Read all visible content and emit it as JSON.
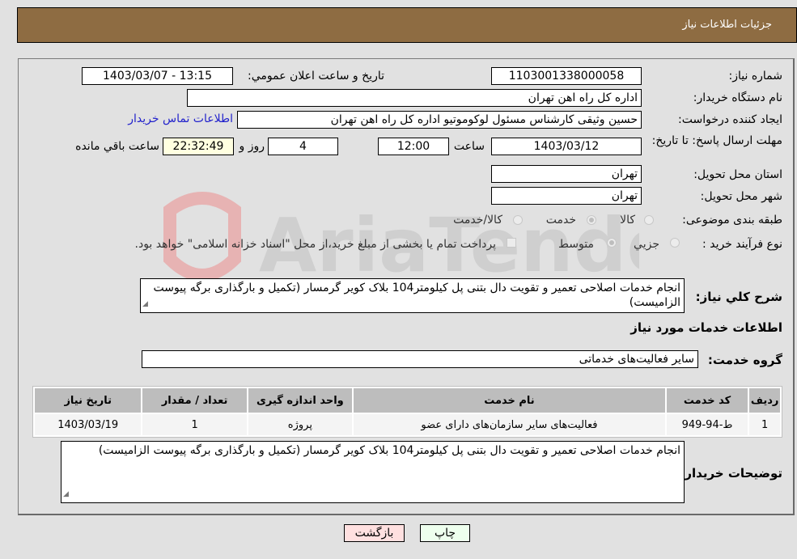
{
  "header": {
    "title": "جزئیات اطلاعات نیاز"
  },
  "form": {
    "need_number": {
      "label": "شماره نیاز:",
      "value": "1103001338000058"
    },
    "announce_datetime": {
      "label": "تاریخ و ساعت اعلان عمومي:",
      "value": "1403/03/07 - 13:15"
    },
    "buyer_org": {
      "label": "نام دستگاه خریدار:",
      "value": "اداره کل راه اهن تهران"
    },
    "requester": {
      "label": "ایجاد کننده درخواست:",
      "value": "حسین وثیقی کارشناس مسئول لوکوموتیو اداره کل راه اهن تهران"
    },
    "contact_link": "اطلاعات تماس خریدار",
    "deadline": {
      "label": "مهلت ارسال پاسخ: تا تاریخ:",
      "date": "1403/03/12",
      "time_label": "ساعت",
      "time": "12:00",
      "days": "4",
      "days_label": "روز و",
      "remaining": "22:32:49",
      "remaining_label": "ساعت باقي مانده"
    },
    "province": {
      "label": "استان محل تحویل:",
      "value": "تهران"
    },
    "city": {
      "label": "شهر محل تحویل:",
      "value": "تهران"
    },
    "category": {
      "label": "طبقه بندی موضوعی:",
      "options": [
        "کالا",
        "خدمت",
        "کالا/خدمت"
      ],
      "selected": "خدمت"
    },
    "purchase_type": {
      "label": "نوع فرآیند خرید :",
      "options": [
        "جزيي",
        "متوسط"
      ],
      "selected": "متوسط",
      "treasury_note": "پرداخت تمام یا بخشی از مبلغ خرید،از محل \"اسناد خزانه اسلامی\" خواهد بود."
    },
    "general_description": {
      "label": "شرح کلي نیاز:",
      "value": "انجام خدمات اصلاحی تعمیر و تقویت دال بتنی پل کیلومتر104 بلاک کویر گرمسار (تکمیل و بارگذاری برگه پیوست الزامیست)"
    }
  },
  "services": {
    "section_title": "اطلاعات خدمات مورد نیاز",
    "group_label": "گروه خدمت:",
    "group_value": "سایر فعالیت‌های خدماتی",
    "columns": [
      "ردیف",
      "کد خدمت",
      "نام خدمت",
      "واحد اندازه گیری",
      "تعداد / مقدار",
      "تاریخ نیاز"
    ],
    "rows": [
      [
        "1",
        "ط-94-949",
        "فعالیت‌های سایر سازمان‌های دارای عضو",
        "پروژه",
        "1",
        "1403/03/19"
      ]
    ]
  },
  "buyer_notes": {
    "label": "توضیحات خریدار:",
    "value": "انجام خدمات اصلاحی تعمیر و تقویت دال بتنی پل کیلومتر104 بلاک کویر گرمسار (تکمیل و بارگذاری برگه پیوست الزامیست)"
  },
  "buttons": {
    "print": "چاپ",
    "back": "بازگشت"
  },
  "watermark": {
    "text": "AriaTender.neT"
  },
  "colors": {
    "header_bg": "#8e6c42",
    "print_bg": "#eeffee",
    "back_bg": "#ffe0e0",
    "link": "#2222cc"
  }
}
